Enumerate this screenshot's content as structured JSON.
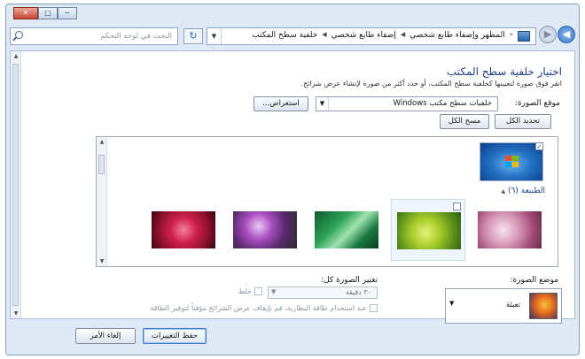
{
  "titlebar": {
    "buttons": [
      "─",
      "□",
      "✕"
    ]
  },
  "address": {
    "search_placeholder": "البحث في لوحة التحكم",
    "breadcrumbs": [
      "المظهر وإضفاء طابع شخصي",
      "إضفاء طابع شخصي",
      "خلفية سطح المكتب"
    ],
    "nav_back": "◀",
    "nav_forward": "▶",
    "refresh": "↻",
    "dropdown": "▼",
    "overflow": "«"
  },
  "page": {
    "title": "اختيار خلفية سطح المكتب",
    "subtitle": "انقر فوق صورة لتعيينها كخلفية سطح المكتب، أو حدد أكثر من صورة لإنشاء عرض شرائح.",
    "picture_location_label": "موقع الصورة:",
    "picture_location_value": "خلفيات سطح مكتب Windows",
    "browse_button": "استعراض...",
    "select_all_button": "تحديد الكل",
    "clear_all_button": "مسح الكل",
    "group_label": "الطبيعة (٦)",
    "group_toggle": "▲",
    "checked_mark": "✓"
  },
  "gallery": {
    "colors": {
      "win7": "#2572c6",
      "selection": "#eef5ff"
    },
    "thumbnails": [
      {
        "name": "flower-pink",
        "checked": false
      },
      {
        "name": "leaves-green",
        "checked": false
      },
      {
        "name": "plant-green",
        "checked": false
      },
      {
        "name": "thistle-purple",
        "checked": false
      },
      {
        "name": "flower-red",
        "checked": false
      }
    ]
  },
  "position": {
    "label": "موضع الصورة:",
    "value": "تعبئة"
  },
  "change": {
    "label": "تغيير الصورة كل:",
    "interval": "٣٠ دقيقة",
    "shuffle": "خلط",
    "battery": "عند استخدام طاقة البطارية، قم بإيقاف عرض الشرائح مؤقتاً لتوفير الطاقة"
  },
  "footer": {
    "save": "حفظ التغييرات",
    "cancel": "إلغاء الأمر"
  }
}
